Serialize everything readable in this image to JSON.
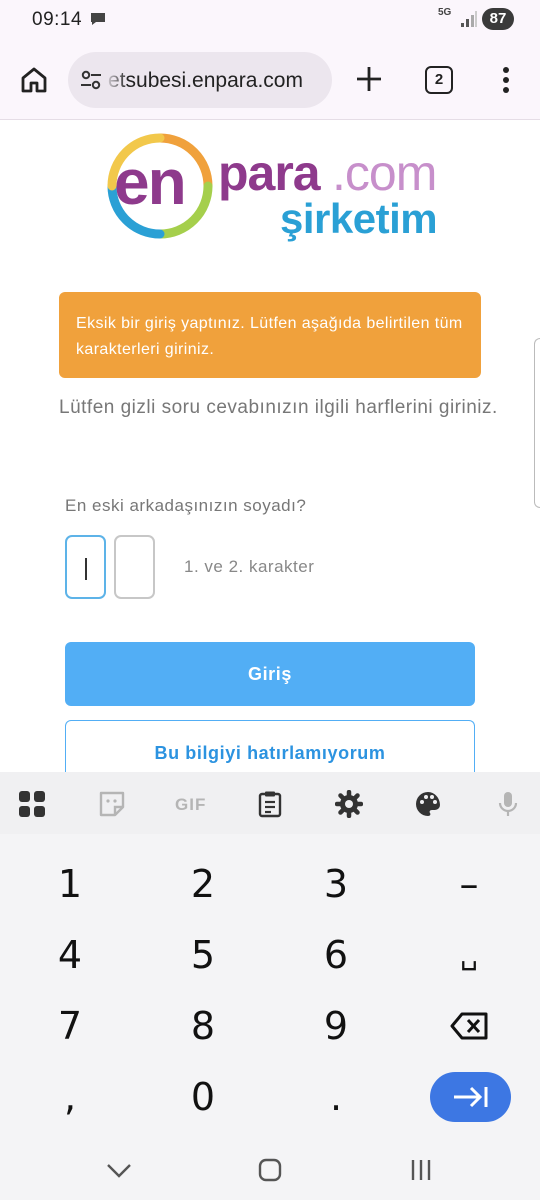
{
  "status_bar": {
    "time": "09:14",
    "network": "5G",
    "battery": "87"
  },
  "browser": {
    "url": "etsubesi.enpara.com",
    "tab_count": "2"
  },
  "logo": {
    "en": "en",
    "para": "para",
    "com": ".com",
    "sirketim": "şirketim",
    "brand_purple": "#8e3a8c",
    "brand_blue": "#2aa0d5"
  },
  "alert": {
    "message": "Eksik bir giriş yaptınız. Lütfen aşağıda belirtilen tüm karakterleri giriniz.",
    "color": "#f0a13c"
  },
  "form": {
    "instruction": "Lütfen gizli soru cevabınızın ilgili harflerini giriniz.",
    "question": "En eski arkadaşınızın soyadı?",
    "char_hint": "1. ve 2. karakter",
    "char_1_value": "",
    "char_2_value": "",
    "login_label": "Giriş",
    "forgot_label": "Bu bilgiyi hatırlamıyorum",
    "primary_color": "#52aef5"
  },
  "keyboard": {
    "toolbar": {
      "gif_label": "GIF",
      "icons": [
        "apps-grid-icon",
        "sticker-icon",
        "gif-icon",
        "clipboard-icon",
        "settings-icon",
        "palette-icon",
        "microphone-icon"
      ]
    },
    "keys": {
      "k1": "1",
      "k2": "2",
      "k3": "3",
      "minus": "–",
      "k4": "4",
      "k5": "5",
      "k6": "6",
      "space": "␣",
      "k7": "7",
      "k8": "8",
      "k9": "9",
      "comma": ",",
      "k0": "0",
      "period": "."
    },
    "enter_color": "#3d77e3"
  }
}
